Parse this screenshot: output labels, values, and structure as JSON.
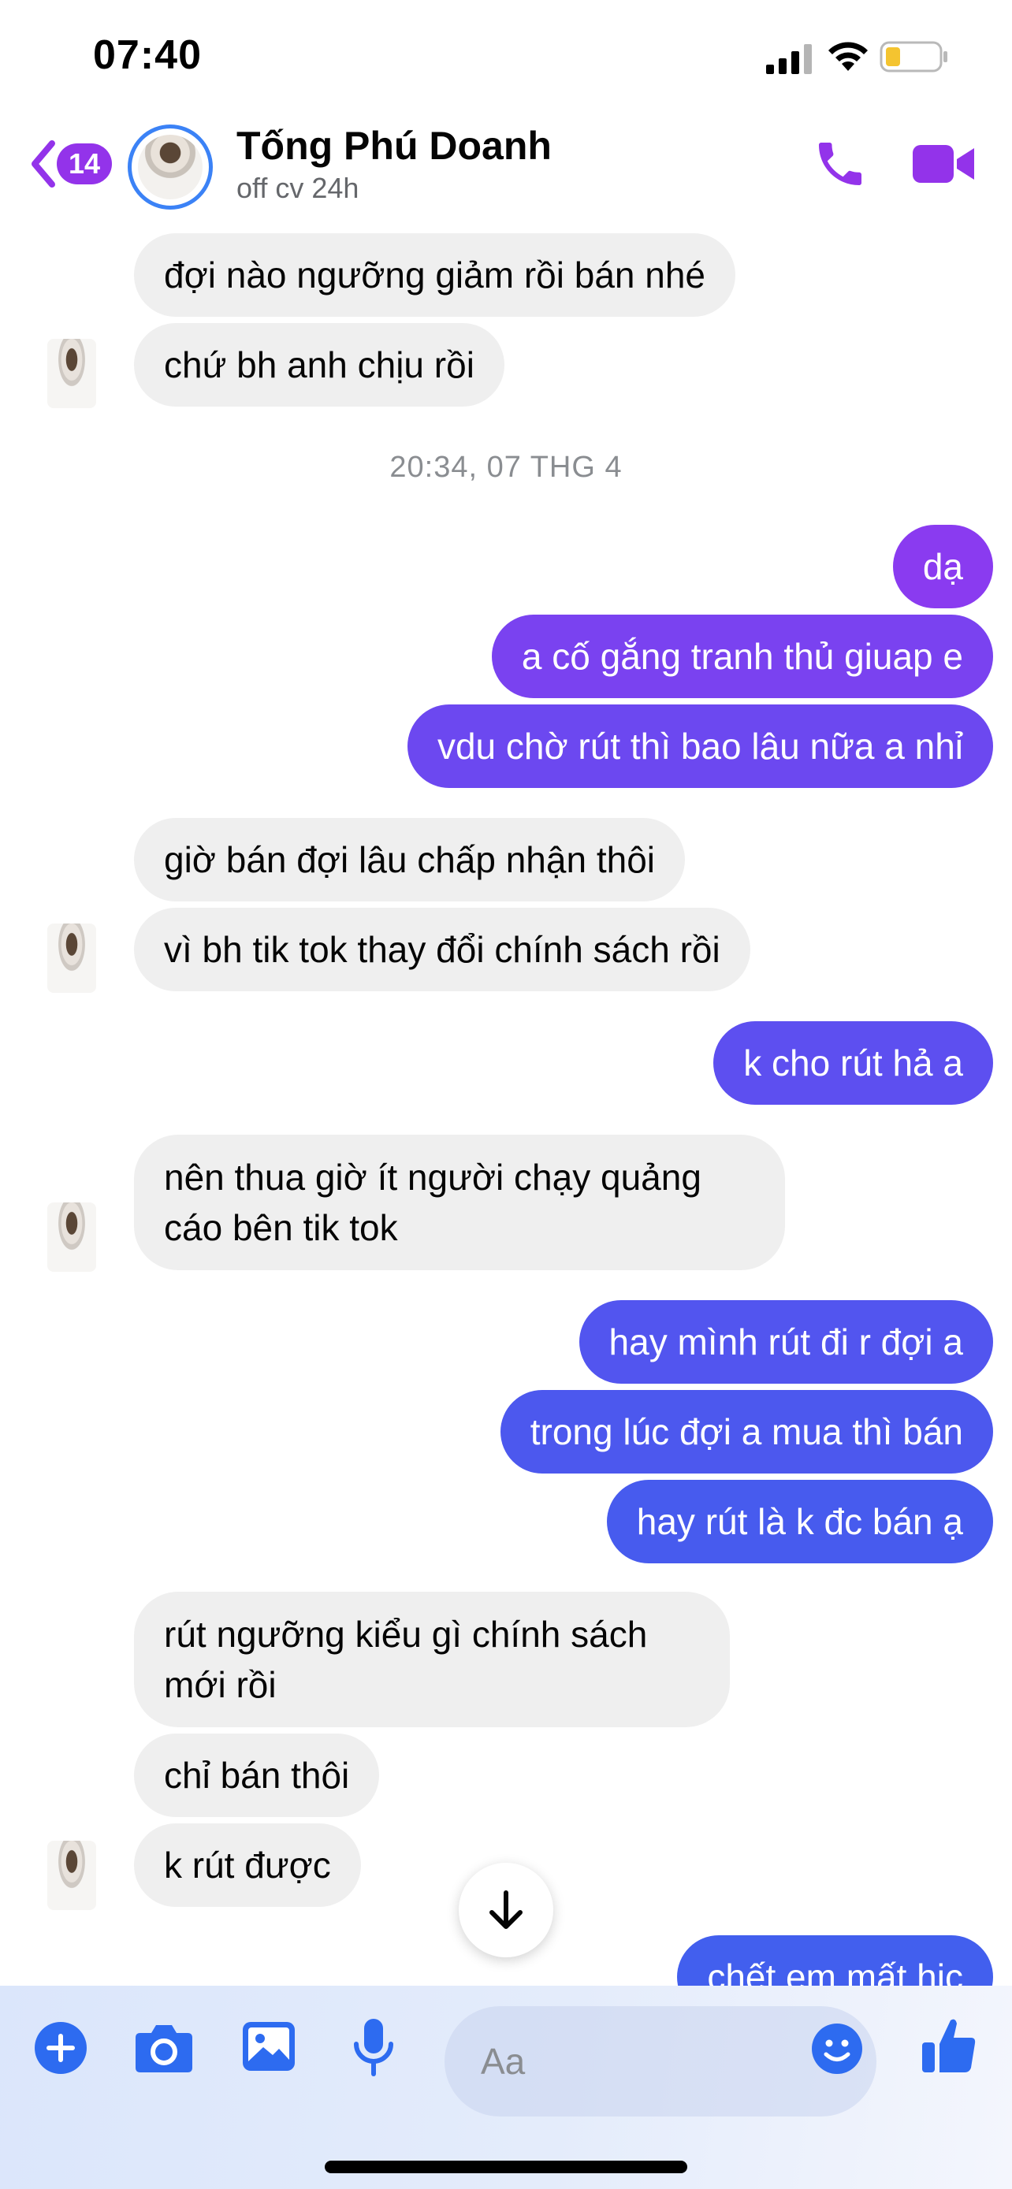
{
  "status_bar": {
    "time": "07:40"
  },
  "header": {
    "back_count": "14",
    "name": "Tống Phú Doanh",
    "status": "off cv 24h"
  },
  "colors": {
    "accent": "#9333ea",
    "out_gradient_top": "#8b3bf0",
    "out_gradient_bottom": "#4a5ff0",
    "incoming": "#efefef"
  },
  "conversation": {
    "timestamp": "20:34, 07 THG 4",
    "messages": [
      {
        "side": "in",
        "text": "đợi nào ngưỡng giảm rồi bán nhé"
      },
      {
        "side": "in",
        "text": "chứ bh anh chịu rồi"
      },
      {
        "side": "out",
        "text": "dạ"
      },
      {
        "side": "out",
        "text": "a cố gắng tranh thủ giuap e"
      },
      {
        "side": "out",
        "text": "vdu chờ rút thì bao lâu nữa a nhỉ"
      },
      {
        "side": "in",
        "text": "giờ bán đợi lâu chấp nhận thôi"
      },
      {
        "side": "in",
        "text": "vì bh tik tok thay đổi chính sách rồi"
      },
      {
        "side": "out",
        "text": "k cho rút hả a"
      },
      {
        "side": "in",
        "text": "nên thua giờ ít người chạy quảng cáo bên tik tok"
      },
      {
        "side": "out",
        "text": "hay mình rút đi r đợi a"
      },
      {
        "side": "out",
        "text": "trong lúc đợi a mua thì bán"
      },
      {
        "side": "out",
        "text": "hay rút là k đc bán ạ"
      },
      {
        "side": "in",
        "text": "rút ngưỡng kiểu gì chính sách mới rồi"
      },
      {
        "side": "in",
        "text": "chỉ bán thôi"
      },
      {
        "side": "in",
        "text": "k rút được"
      },
      {
        "side": "out",
        "text": "chết em mất hic"
      }
    ]
  },
  "composer": {
    "placeholder": "Aa",
    "icons": [
      "plus-icon",
      "camera-icon",
      "image-icon",
      "microphone-icon",
      "emoji-icon",
      "thumbs-up-icon"
    ]
  }
}
